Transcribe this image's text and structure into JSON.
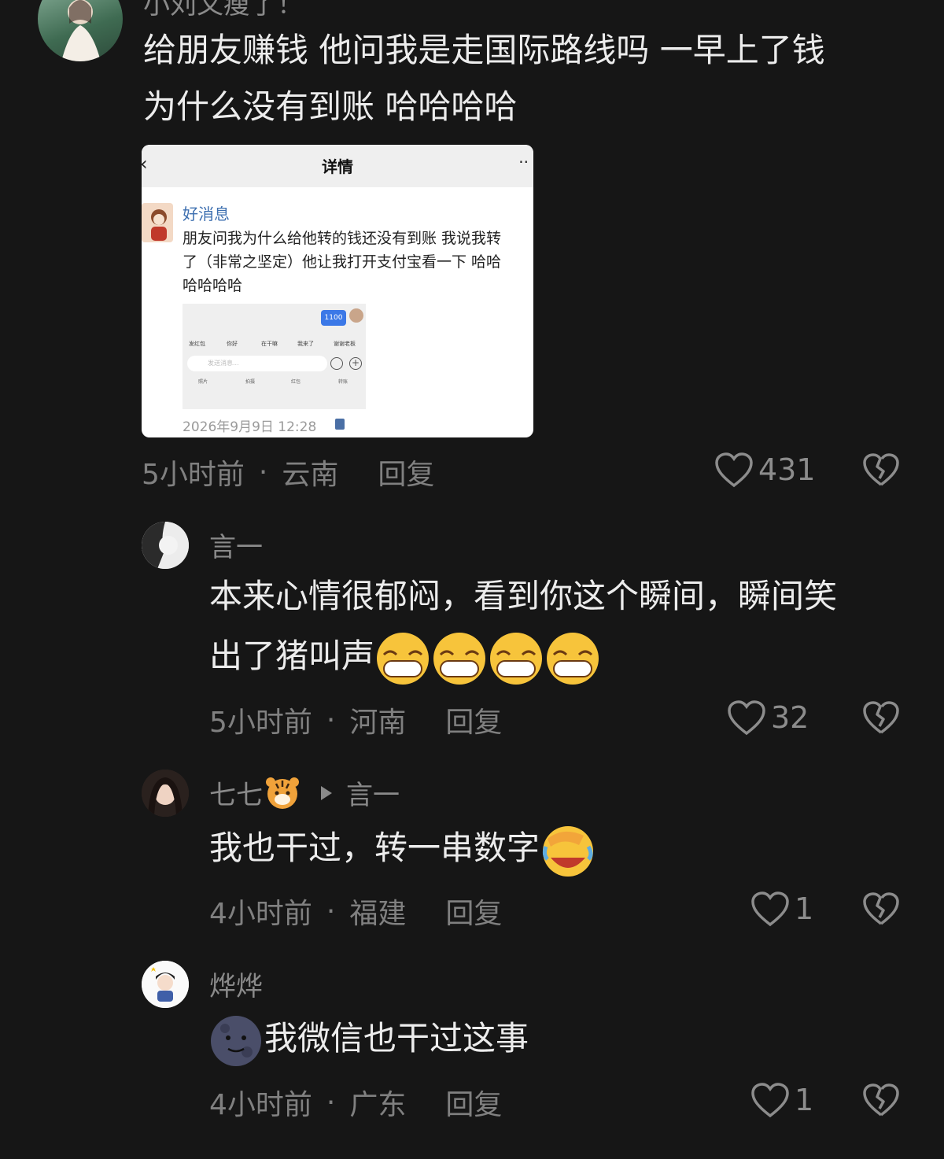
{
  "comments": [
    {
      "username": "小刘又瘦了！",
      "text_line1": "给朋友赚钱 他问我是走国际路线吗 一早上了钱",
      "text_line2": "为什么没有到账 哈哈哈哈",
      "time": "5小时前",
      "location": "云南",
      "reply": "回复",
      "likes": "431"
    },
    {
      "username": "言一",
      "text_line1": "本来心情很郁闷，看到你这个瞬间，瞬间笑",
      "text_line2": "出了猪叫声",
      "emojis": [
        "grin-emoji",
        "grin-emoji",
        "grin-emoji",
        "grin-emoji"
      ],
      "time": "5小时前",
      "location": "河南",
      "reply": "回复",
      "likes": "32"
    },
    {
      "username": "七七",
      "reply_to": "言一",
      "text": "我也干过，转一串数字",
      "time": "4小时前",
      "location": "福建",
      "reply": "回复",
      "likes": "1"
    },
    {
      "username": "烨烨",
      "text": "我微信也干过这事",
      "time": "4小时前",
      "location": "广东",
      "reply": "回复",
      "likes": "1"
    }
  ],
  "screenshot_card": {
    "title": "详情",
    "back": "‹",
    "more": "··",
    "msg_title": "好消息",
    "msg_body": "朋友问我为什么给他转的钱还没有到账 我说我转\n了（非常之坚定）他让我打开支付宝看一下 哈哈\n哈哈哈哈",
    "bubble_amount": "1100",
    "quick_replies": [
      "发红包",
      "你好",
      "在干嘛",
      "我来了",
      "谢谢老板"
    ],
    "input_placeholder": "发送消息...",
    "tools": [
      "照片",
      "拍摄",
      "红包",
      "转账"
    ],
    "date": "2026年9月9日 12:28"
  },
  "colors": {
    "background": "#161616",
    "text": "#ececec",
    "meta": "#808080",
    "link": "#3d6fb0"
  }
}
